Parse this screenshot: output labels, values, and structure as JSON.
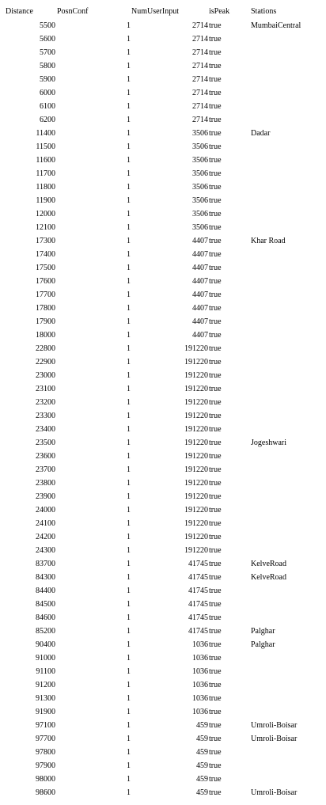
{
  "table": {
    "headers": {
      "distance": "Distance",
      "posnconf": "PosnConf",
      "numuserinput": "NumUserInput",
      "ispeak": "isPeak",
      "stations": "Stations"
    },
    "rows": [
      {
        "distance": "5500",
        "posnconf": "1",
        "numuserinput": "2714",
        "ispeak": "true",
        "stations": "MumbaiCentral"
      },
      {
        "distance": "5600",
        "posnconf": "1",
        "numuserinput": "2714",
        "ispeak": "true",
        "stations": ""
      },
      {
        "distance": "5700",
        "posnconf": "1",
        "numuserinput": "2714",
        "ispeak": "true",
        "stations": ""
      },
      {
        "distance": "5800",
        "posnconf": "1",
        "numuserinput": "2714",
        "ispeak": "true",
        "stations": ""
      },
      {
        "distance": "5900",
        "posnconf": "1",
        "numuserinput": "2714",
        "ispeak": "true",
        "stations": ""
      },
      {
        "distance": "6000",
        "posnconf": "1",
        "numuserinput": "2714",
        "ispeak": "true",
        "stations": ""
      },
      {
        "distance": "6100",
        "posnconf": "1",
        "numuserinput": "2714",
        "ispeak": "true",
        "stations": ""
      },
      {
        "distance": "6200",
        "posnconf": "1",
        "numuserinput": "2714",
        "ispeak": "true",
        "stations": ""
      },
      {
        "distance": "11400",
        "posnconf": "1",
        "numuserinput": "3506",
        "ispeak": "true",
        "stations": "Dadar"
      },
      {
        "distance": "11500",
        "posnconf": "1",
        "numuserinput": "3506",
        "ispeak": "true",
        "stations": ""
      },
      {
        "distance": "11600",
        "posnconf": "1",
        "numuserinput": "3506",
        "ispeak": "true",
        "stations": ""
      },
      {
        "distance": "11700",
        "posnconf": "1",
        "numuserinput": "3506",
        "ispeak": "true",
        "stations": ""
      },
      {
        "distance": "11800",
        "posnconf": "1",
        "numuserinput": "3506",
        "ispeak": "true",
        "stations": ""
      },
      {
        "distance": "11900",
        "posnconf": "1",
        "numuserinput": "3506",
        "ispeak": "true",
        "stations": ""
      },
      {
        "distance": "12000",
        "posnconf": "1",
        "numuserinput": "3506",
        "ispeak": "true",
        "stations": ""
      },
      {
        "distance": "12100",
        "posnconf": "1",
        "numuserinput": "3506",
        "ispeak": "true",
        "stations": ""
      },
      {
        "distance": "17300",
        "posnconf": "1",
        "numuserinput": "4407",
        "ispeak": "true",
        "stations": "Khar Road"
      },
      {
        "distance": "17400",
        "posnconf": "1",
        "numuserinput": "4407",
        "ispeak": "true",
        "stations": ""
      },
      {
        "distance": "17500",
        "posnconf": "1",
        "numuserinput": "4407",
        "ispeak": "true",
        "stations": ""
      },
      {
        "distance": "17600",
        "posnconf": "1",
        "numuserinput": "4407",
        "ispeak": "true",
        "stations": ""
      },
      {
        "distance": "17700",
        "posnconf": "1",
        "numuserinput": "4407",
        "ispeak": "true",
        "stations": ""
      },
      {
        "distance": "17800",
        "posnconf": "1",
        "numuserinput": "4407",
        "ispeak": "true",
        "stations": ""
      },
      {
        "distance": "17900",
        "posnconf": "1",
        "numuserinput": "4407",
        "ispeak": "true",
        "stations": ""
      },
      {
        "distance": "18000",
        "posnconf": "1",
        "numuserinput": "4407",
        "ispeak": "true",
        "stations": ""
      },
      {
        "distance": "22800",
        "posnconf": "1",
        "numuserinput": "191220",
        "ispeak": "true",
        "stations": ""
      },
      {
        "distance": "22900",
        "posnconf": "1",
        "numuserinput": "191220",
        "ispeak": "true",
        "stations": ""
      },
      {
        "distance": "23000",
        "posnconf": "1",
        "numuserinput": "191220",
        "ispeak": "true",
        "stations": ""
      },
      {
        "distance": "23100",
        "posnconf": "1",
        "numuserinput": "191220",
        "ispeak": "true",
        "stations": ""
      },
      {
        "distance": "23200",
        "posnconf": "1",
        "numuserinput": "191220",
        "ispeak": "true",
        "stations": ""
      },
      {
        "distance": "23300",
        "posnconf": "1",
        "numuserinput": "191220",
        "ispeak": "true",
        "stations": ""
      },
      {
        "distance": "23400",
        "posnconf": "1",
        "numuserinput": "191220",
        "ispeak": "true",
        "stations": ""
      },
      {
        "distance": "23500",
        "posnconf": "1",
        "numuserinput": "191220",
        "ispeak": "true",
        "stations": "Jogeshwari"
      },
      {
        "distance": "23600",
        "posnconf": "1",
        "numuserinput": "191220",
        "ispeak": "true",
        "stations": ""
      },
      {
        "distance": "23700",
        "posnconf": "1",
        "numuserinput": "191220",
        "ispeak": "true",
        "stations": ""
      },
      {
        "distance": "23800",
        "posnconf": "1",
        "numuserinput": "191220",
        "ispeak": "true",
        "stations": ""
      },
      {
        "distance": "23900",
        "posnconf": "1",
        "numuserinput": "191220",
        "ispeak": "true",
        "stations": ""
      },
      {
        "distance": "24000",
        "posnconf": "1",
        "numuserinput": "191220",
        "ispeak": "true",
        "stations": ""
      },
      {
        "distance": "24100",
        "posnconf": "1",
        "numuserinput": "191220",
        "ispeak": "true",
        "stations": ""
      },
      {
        "distance": "24200",
        "posnconf": "1",
        "numuserinput": "191220",
        "ispeak": "true",
        "stations": ""
      },
      {
        "distance": "24300",
        "posnconf": "1",
        "numuserinput": "191220",
        "ispeak": "true",
        "stations": ""
      },
      {
        "distance": "83700",
        "posnconf": "1",
        "numuserinput": "41745",
        "ispeak": "true",
        "stations": "KelveRoad"
      },
      {
        "distance": "84300",
        "posnconf": "1",
        "numuserinput": "41745",
        "ispeak": "true",
        "stations": "KelveRoad"
      },
      {
        "distance": "84400",
        "posnconf": "1",
        "numuserinput": "41745",
        "ispeak": "true",
        "stations": ""
      },
      {
        "distance": "84500",
        "posnconf": "1",
        "numuserinput": "41745",
        "ispeak": "true",
        "stations": ""
      },
      {
        "distance": "84600",
        "posnconf": "1",
        "numuserinput": "41745",
        "ispeak": "true",
        "stations": ""
      },
      {
        "distance": "85200",
        "posnconf": "1",
        "numuserinput": "41745",
        "ispeak": "true",
        "stations": "Palghar"
      },
      {
        "distance": "90400",
        "posnconf": "1",
        "numuserinput": "1036",
        "ispeak": "true",
        "stations": "Palghar"
      },
      {
        "distance": "91000",
        "posnconf": "1",
        "numuserinput": "1036",
        "ispeak": "true",
        "stations": ""
      },
      {
        "distance": "91100",
        "posnconf": "1",
        "numuserinput": "1036",
        "ispeak": "true",
        "stations": ""
      },
      {
        "distance": "91200",
        "posnconf": "1",
        "numuserinput": "1036",
        "ispeak": "true",
        "stations": ""
      },
      {
        "distance": "91300",
        "posnconf": "1",
        "numuserinput": "1036",
        "ispeak": "true",
        "stations": ""
      },
      {
        "distance": "91900",
        "posnconf": "1",
        "numuserinput": "1036",
        "ispeak": "true",
        "stations": ""
      },
      {
        "distance": "97100",
        "posnconf": "1",
        "numuserinput": "459",
        "ispeak": "true",
        "stations": "Umroli-Boisar"
      },
      {
        "distance": "97700",
        "posnconf": "1",
        "numuserinput": "459",
        "ispeak": "true",
        "stations": "Umroli-Boisar"
      },
      {
        "distance": "97800",
        "posnconf": "1",
        "numuserinput": "459",
        "ispeak": "true",
        "stations": ""
      },
      {
        "distance": "97900",
        "posnconf": "1",
        "numuserinput": "459",
        "ispeak": "true",
        "stations": ""
      },
      {
        "distance": "98000",
        "posnconf": "1",
        "numuserinput": "459",
        "ispeak": "true",
        "stations": ""
      },
      {
        "distance": "98600",
        "posnconf": "1",
        "numuserinput": "459",
        "ispeak": "true",
        "stations": "Umroli-Boisar"
      }
    ]
  }
}
